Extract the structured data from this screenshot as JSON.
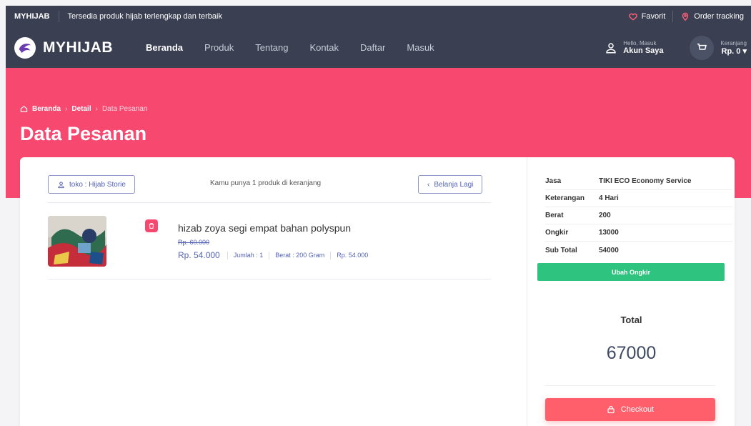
{
  "topbar": {
    "brand": "MYHIJAB",
    "tagline": "Tersedia produk hijab terlengkap dan terbaik",
    "favorite": "Favorit",
    "order_tracking": "Order tracking"
  },
  "nav": {
    "logo_text": "MYHIJAB",
    "menu": [
      "Beranda",
      "Produk",
      "Tentang",
      "Kontak",
      "Daftar",
      "Masuk"
    ],
    "active_menu": "Beranda",
    "account_greeting": "Hello, Masuk",
    "account_label": "Akun Saya",
    "cart_label": "Keranjang",
    "cart_total": "Rp. 0"
  },
  "breadcrumb": {
    "home": "Beranda",
    "detail": "Detail",
    "current": "Data Pesanan"
  },
  "page_title": "Data Pesanan",
  "cart": {
    "store_button": "toko : Hijab Storie",
    "count_text": "Kamu punya 1 produk di keranjang",
    "back_button": "Belanja Lagi",
    "item": {
      "name": "hizab zoya segi empat bahan polyspun",
      "old_price": "Rp. 60.000",
      "price": "Rp. 54.000",
      "qty": "Jumlah : 1",
      "weight": "Berat : 200 Gram",
      "subtotal": "Rp. 54.000"
    }
  },
  "summary": {
    "rows": [
      {
        "key": "Jasa",
        "value": "TIKI ECO Economy Service"
      },
      {
        "key": "Keterangan",
        "value": "4 Hari"
      },
      {
        "key": "Berat",
        "value": "200"
      },
      {
        "key": "Ongkir",
        "value": "13000"
      },
      {
        "key": "Sub Total",
        "value": "54000"
      }
    ],
    "ubah_button": "Ubah Ongkir",
    "total_label": "Total",
    "total_value": "67000",
    "checkout_button": "Checkout"
  },
  "colors": {
    "header_bg": "#3a3f51",
    "hero_pink": "#f74870",
    "green_button": "#2ec47f",
    "checkout_red": "#ff5f6a",
    "accent_blue": "#5563b6"
  }
}
